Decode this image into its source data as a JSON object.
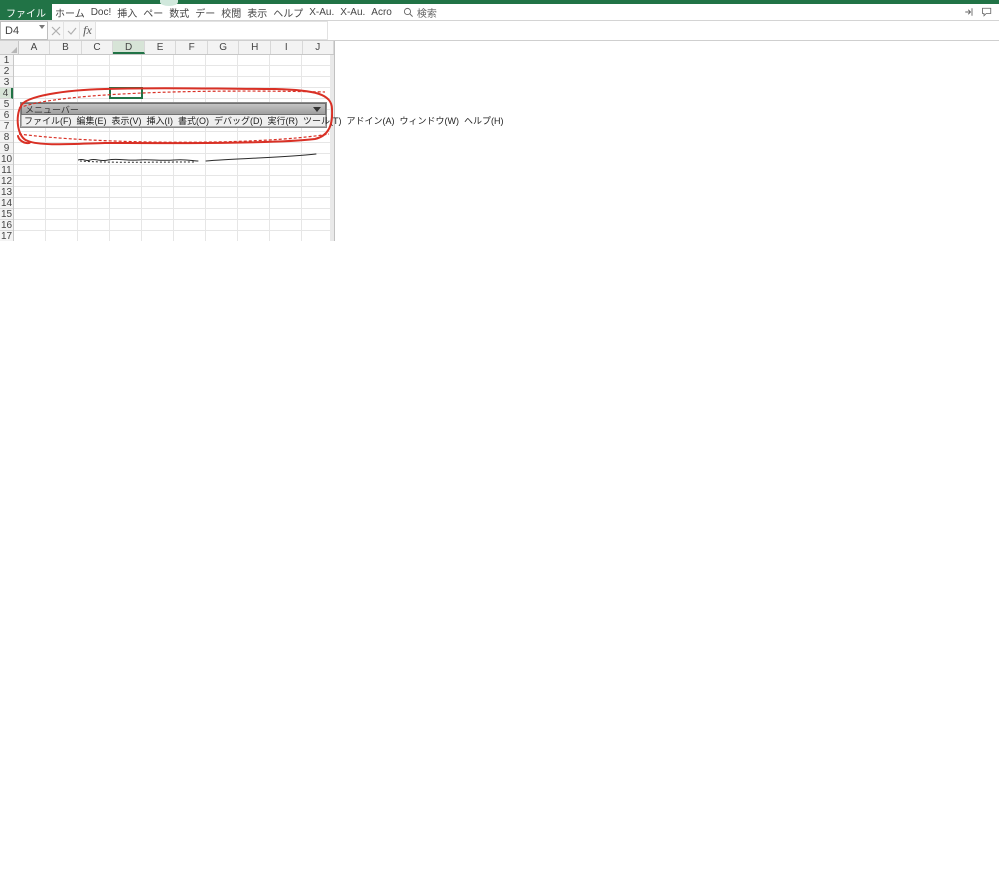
{
  "ribbon": {
    "file": "ファイル",
    "tabs": [
      "ホーム",
      "Doc!",
      "挿入",
      "ペー",
      "数式",
      "デー",
      "校閲",
      "表示",
      "ヘルプ",
      "X-Au.",
      "X-Au.",
      "Acro"
    ],
    "active_index": 7,
    "search_label": "検索"
  },
  "formula_bar": {
    "name_box": "D4",
    "fx_label": "fx"
  },
  "grid": {
    "columns": [
      "A",
      "B",
      "C",
      "D",
      "E",
      "F",
      "G",
      "H",
      "I",
      "J"
    ],
    "rows": [
      "1",
      "2",
      "3",
      "4",
      "5",
      "6",
      "7",
      "8",
      "9",
      "10",
      "11",
      "12",
      "13",
      "14",
      "15",
      "16",
      "17"
    ],
    "selected_col": "D",
    "selected_row": "4"
  },
  "inset": {
    "title": "メニューバー",
    "menu": [
      "ファイル(F)",
      "編集(E)",
      "表示(V)",
      "挿入(I)",
      "書式(O)",
      "デバッグ(D)",
      "実行(R)",
      "ツール(T)",
      "アドイン(A)",
      "ウィンドウ(W)",
      "ヘルプ(H)"
    ]
  }
}
